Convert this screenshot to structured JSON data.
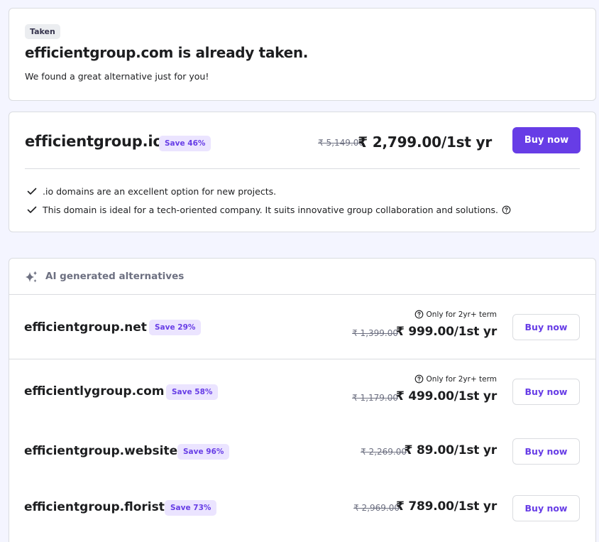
{
  "taken": {
    "badge": "Taken",
    "title": "efficientgroup.com is already taken.",
    "subtitle": "We found a great alternative just for you!"
  },
  "featured": {
    "domain": "efficientgroup.io",
    "save": "Save 46%",
    "old_price": "₹ 5,149.00",
    "new_price": "₹ 2,799.00/1st yr",
    "buy_label": "Buy now",
    "features": [
      ".io domains are an excellent option for new projects.",
      "This domain is ideal for a tech-oriented company. It suits innovative group collaboration and solutions."
    ]
  },
  "alternatives": {
    "title": "AI generated alternatives",
    "items": [
      {
        "domain": "efficientgroup.net",
        "save": "Save 29%",
        "term_note": "Only for 2yr+ term",
        "old_price": "₹ 1,399.00",
        "new_price": "₹ 999.00/1st yr",
        "buy_label": "Buy now"
      },
      {
        "domain": "efficientlygroup.com",
        "save": "Save 58%",
        "term_note": "Only for 2yr+ term",
        "old_price": "₹ 1,179.00",
        "new_price": "₹ 499.00/1st yr",
        "buy_label": "Buy now"
      },
      {
        "domain": "efficientgroup.website",
        "save": "Save 96%",
        "old_price": "₹ 2,269.00",
        "new_price": "₹ 89.00/1st yr",
        "buy_label": "Buy now"
      },
      {
        "domain": "efficientgroup.florist",
        "save": "Save 73%",
        "old_price": "₹ 2,969.00",
        "new_price": "₹ 789.00/1st yr",
        "buy_label": "Buy now"
      }
    ]
  },
  "colors": {
    "primary": "#673de6",
    "save_badge_bg": "#ebe4ff",
    "page_bg": "#f4f5ff",
    "muted_text": "#6d7081"
  },
  "icons": [
    "check-icon",
    "help-circle-icon",
    "sparkles-icon"
  ]
}
